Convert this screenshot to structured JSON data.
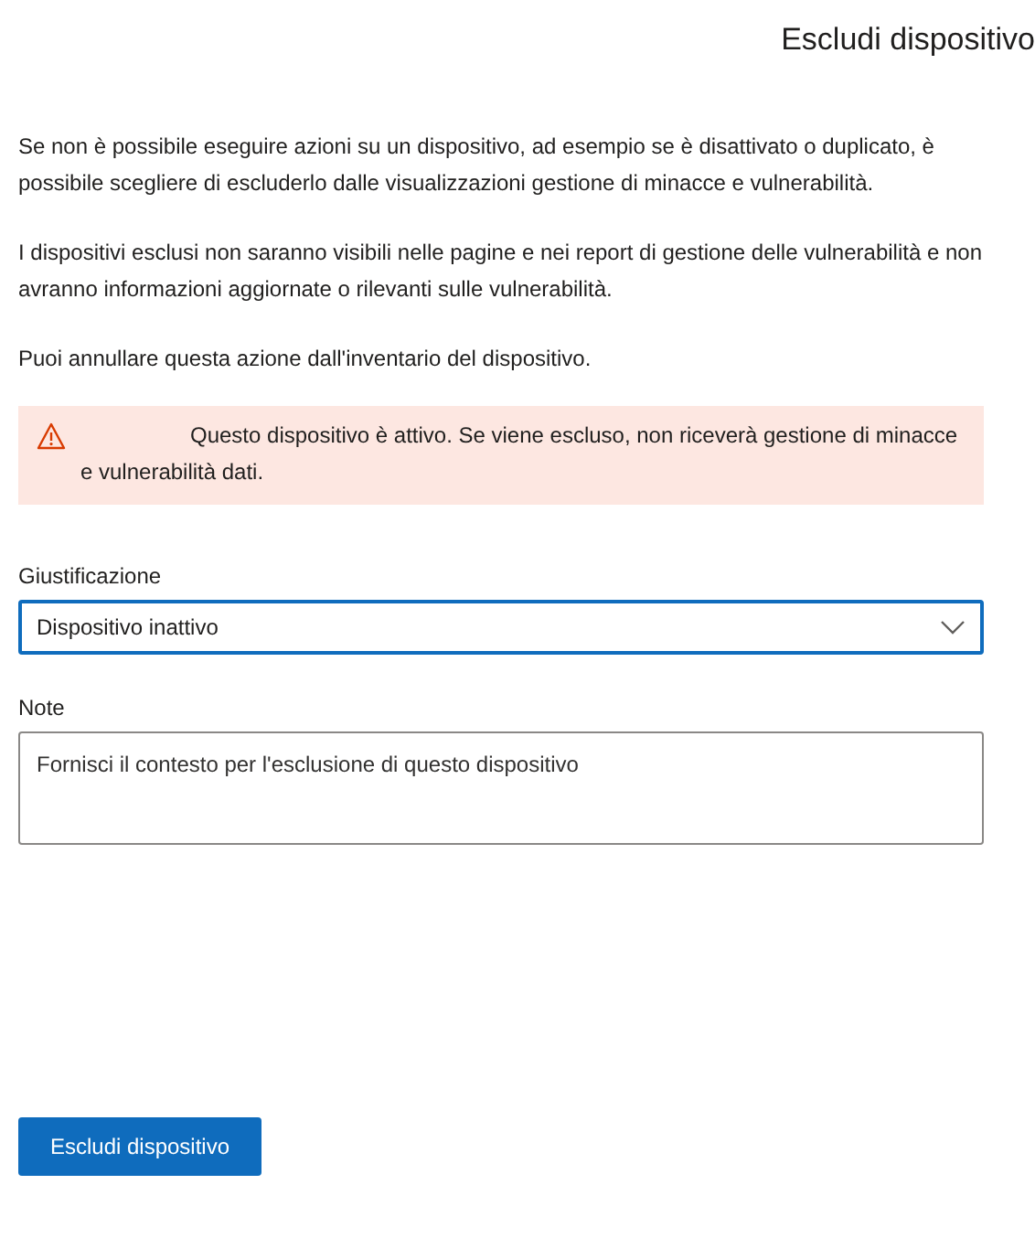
{
  "title": "Escludi dispositivo",
  "paragraphs": [
    "Se non è possibile eseguire azioni su un dispositivo, ad esempio se è disattivato o duplicato, è possibile scegliere di escluderlo dalle visualizzazioni gestione di minacce e vulnerabilità.",
    "I dispositivi esclusi non saranno visibili nelle pagine e nei report di gestione delle vulnerabilità e non avranno informazioni aggiornate o rilevanti sulle vulnerabilità.",
    "Puoi annullare questa azione dall'inventario del dispositivo."
  ],
  "warning": {
    "text": "Questo dispositivo è attivo. Se viene escluso, non riceverà gestione di minacce e vulnerabilità dati."
  },
  "justification": {
    "label": "Giustificazione",
    "value": "Dispositivo inattivo"
  },
  "notes": {
    "label": "Note",
    "placeholder": "Fornisci il contesto per l'esclusione di questo dispositivo"
  },
  "submit_button": "Escludi dispositivo"
}
